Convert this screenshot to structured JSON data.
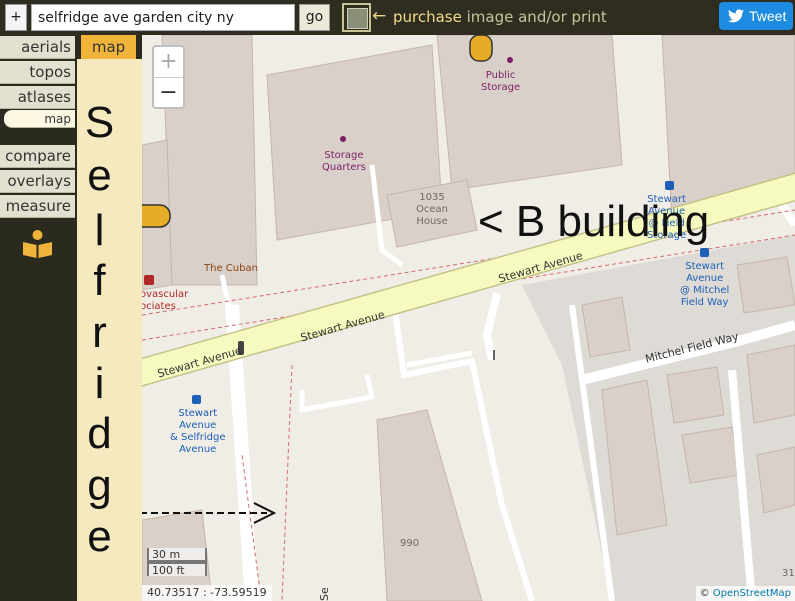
{
  "topbar": {
    "plus_label": "+",
    "search_value": "selfridge ave garden city ny",
    "go_label": "go",
    "purchase_arrow": "←",
    "purchase_strong": "purchase",
    "purchase_rest": " image and/or print",
    "tweet_label": "Tweet"
  },
  "sidebar": {
    "items": [
      {
        "label": "aerials"
      },
      {
        "label": "topos"
      },
      {
        "label": "atlases"
      },
      {
        "label": "map"
      },
      {
        "label": "compare"
      },
      {
        "label": "overlays"
      },
      {
        "label": "measure"
      }
    ],
    "book_icon": "book-icon",
    "map_tab": "map"
  },
  "annotation": {
    "vertical_letters": [
      "S",
      "e",
      "l",
      "f",
      "r",
      "i",
      "d",
      "g",
      "e"
    ],
    "building_label": "< B building"
  },
  "map": {
    "zoom_in": "+",
    "zoom_out": "−",
    "pois": {
      "public_storage": "Public\nStorage",
      "storage_quarters": "Storage\nQuarters",
      "ocean_house": "1035\nOcean\nHouse",
      "the_cuban": "The Cuban",
      "cardiovascular": "ovascular\nociates",
      "stewart_avenue_bus1": "Stewart\nAvenue\n@ Mitchel\nField Way",
      "stewart_avenue_bus_top": "Stewart\nAvenue\n@ Field\nStorage",
      "stewart_selfridge_bus": "Stewart\nAvenue\n& Selfridge\nAvenue",
      "number_990": "990",
      "number_31": "31"
    },
    "streets": {
      "stewart_1": "Stewart Avenue",
      "stewart_2": "Stewart Avenue",
      "stewart_3": "Stewart Avenue",
      "mitchel": "Mitchel Field Way",
      "selfridge_edge": "Se"
    },
    "scale_metric": "30 m",
    "scale_imperial": "100 ft",
    "coords": "40.73517 : -73.59519",
    "attribution_prefix": "© ",
    "attribution_link": "OpenStreetMap",
    "colors": {
      "road_major": "#f7fabf",
      "road_major_border": "#c6c28a",
      "building": "#d9d0c9",
      "building_border": "#c4b6ab",
      "parking": "#e0dcd8",
      "boundary_dashed": "#d36b6b"
    }
  }
}
